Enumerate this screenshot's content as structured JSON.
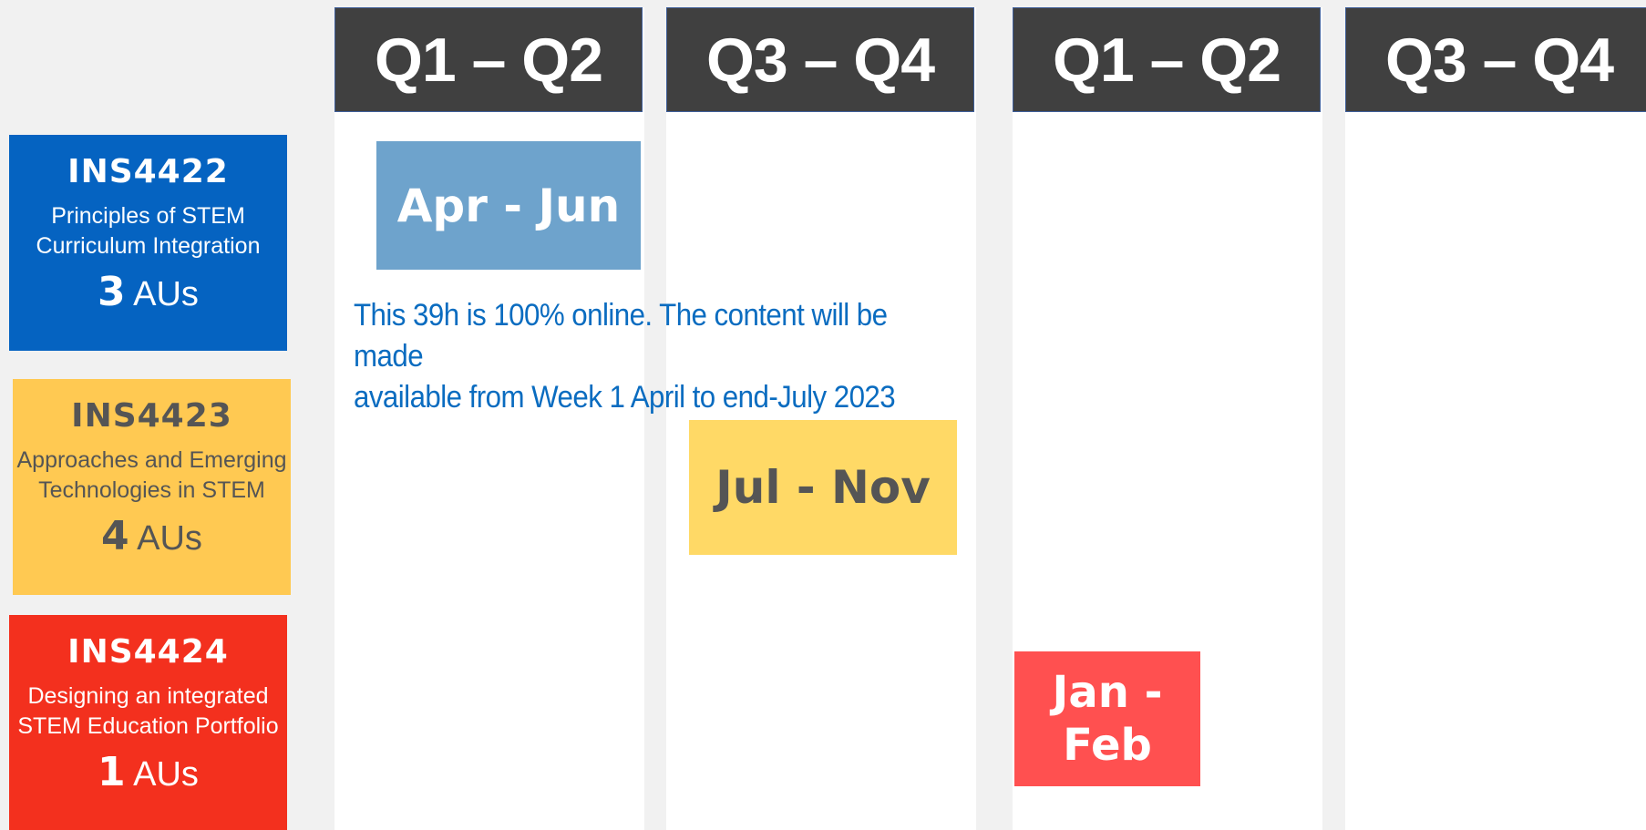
{
  "columns": [
    {
      "label": "Q1 – Q2"
    },
    {
      "label": "Q3 – Q4"
    },
    {
      "label": "Q1 – Q2"
    },
    {
      "label": "Q3 – Q4"
    }
  ],
  "courses": [
    {
      "code": "INS4422",
      "name_line1": "Principles of STEM",
      "name_line2": "Curriculum Integration",
      "au_value": "3",
      "au_unit": "AUs",
      "color": "#0563c1"
    },
    {
      "code": "INS4423",
      "name_line1": "Approaches and Emerging",
      "name_line2": "Technologies in STEM",
      "au_value": "4",
      "au_unit": "AUs",
      "color": "#ffc952"
    },
    {
      "code": "INS4424",
      "name_line1": "Designing an integrated",
      "name_line2": "STEM Education Portfolio",
      "au_value": "1",
      "au_unit": "AUs",
      "color": "#f3301e"
    }
  ],
  "schedule_bars": [
    {
      "label": "Apr - Jun",
      "color": "#6ea3cc"
    },
    {
      "label": "Jul - Nov",
      "color": "#ffd966"
    },
    {
      "label_line1": "Jan -",
      "label_line2": "Feb",
      "color": "#ff5050"
    }
  ],
  "note": {
    "line1": "This 39h is 100% online. The content will be made",
    "line2": "available from Week 1 April to end-July 2023"
  }
}
